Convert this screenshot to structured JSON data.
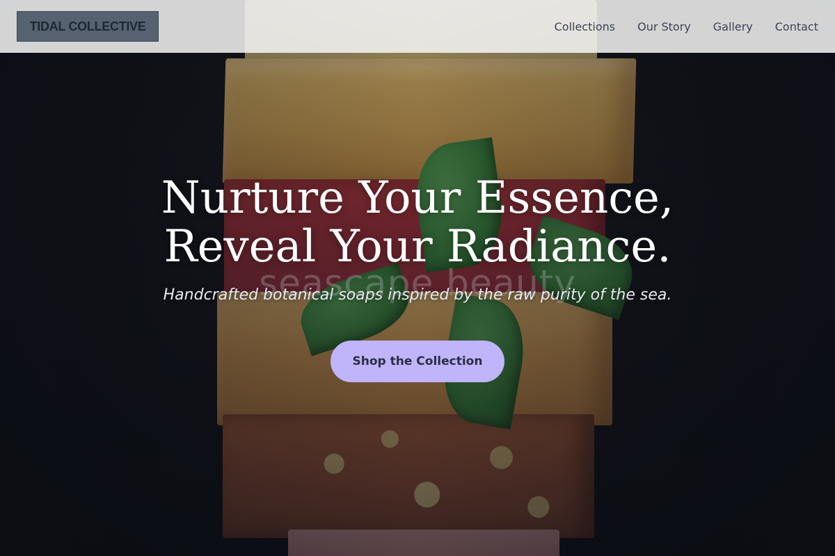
{
  "header": {
    "logo_text": "TIDAL COLLECTIVE",
    "nav": [
      {
        "label": "Collections"
      },
      {
        "label": "Our Story"
      },
      {
        "label": "Gallery"
      },
      {
        "label": "Contact"
      }
    ]
  },
  "hero": {
    "title_line_1": "Nurture Your Essence,",
    "title_line_2": "Reveal Your Radiance.",
    "watermark": "seascape beauty",
    "subtitle": "Handcrafted botanical soaps inspired by the raw purity of the sea.",
    "cta_label": "Shop the Collection"
  },
  "colors": {
    "header_bg": "#f4f4f4",
    "logo_bg": "#566270",
    "cta_bg": "#c0b4fb",
    "cta_text": "#2a2f44",
    "nav_text": "#3a4352"
  }
}
